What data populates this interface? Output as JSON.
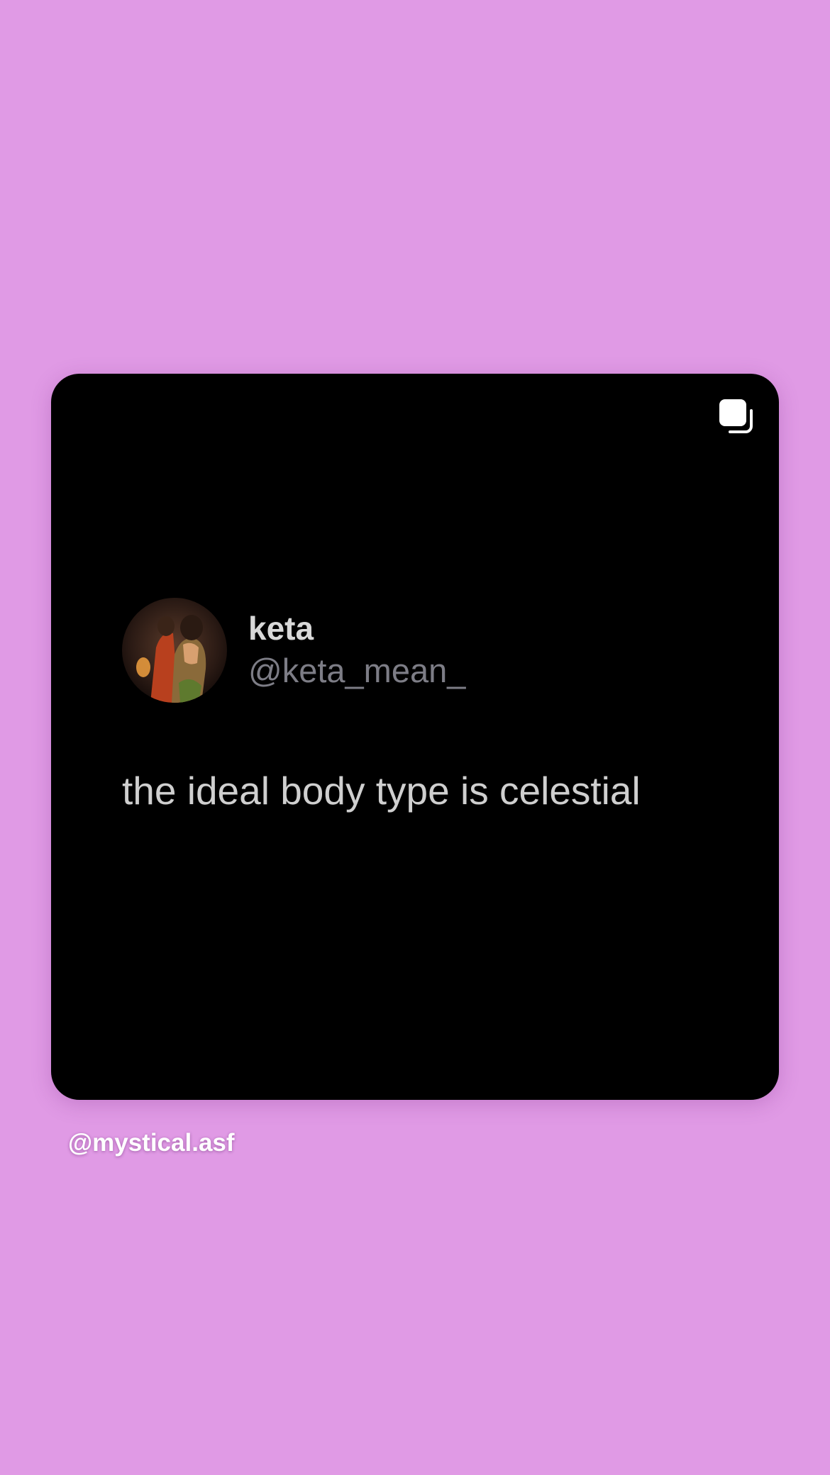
{
  "colors": {
    "background": "#e09ae5",
    "card": "#000000",
    "display_name": "#d8d8d8",
    "handle": "#7d7d86",
    "tweet_text": "#cfcfcf",
    "credit": "#ffffff"
  },
  "post": {
    "carousel_icon": "multiple-images-icon",
    "tweet": {
      "avatar_icon": "profile-avatar",
      "display_name": "keta",
      "handle": "@keta_mean_",
      "text": "the ideal body type is celestial"
    }
  },
  "credit": {
    "label": "@mystical.asf"
  }
}
